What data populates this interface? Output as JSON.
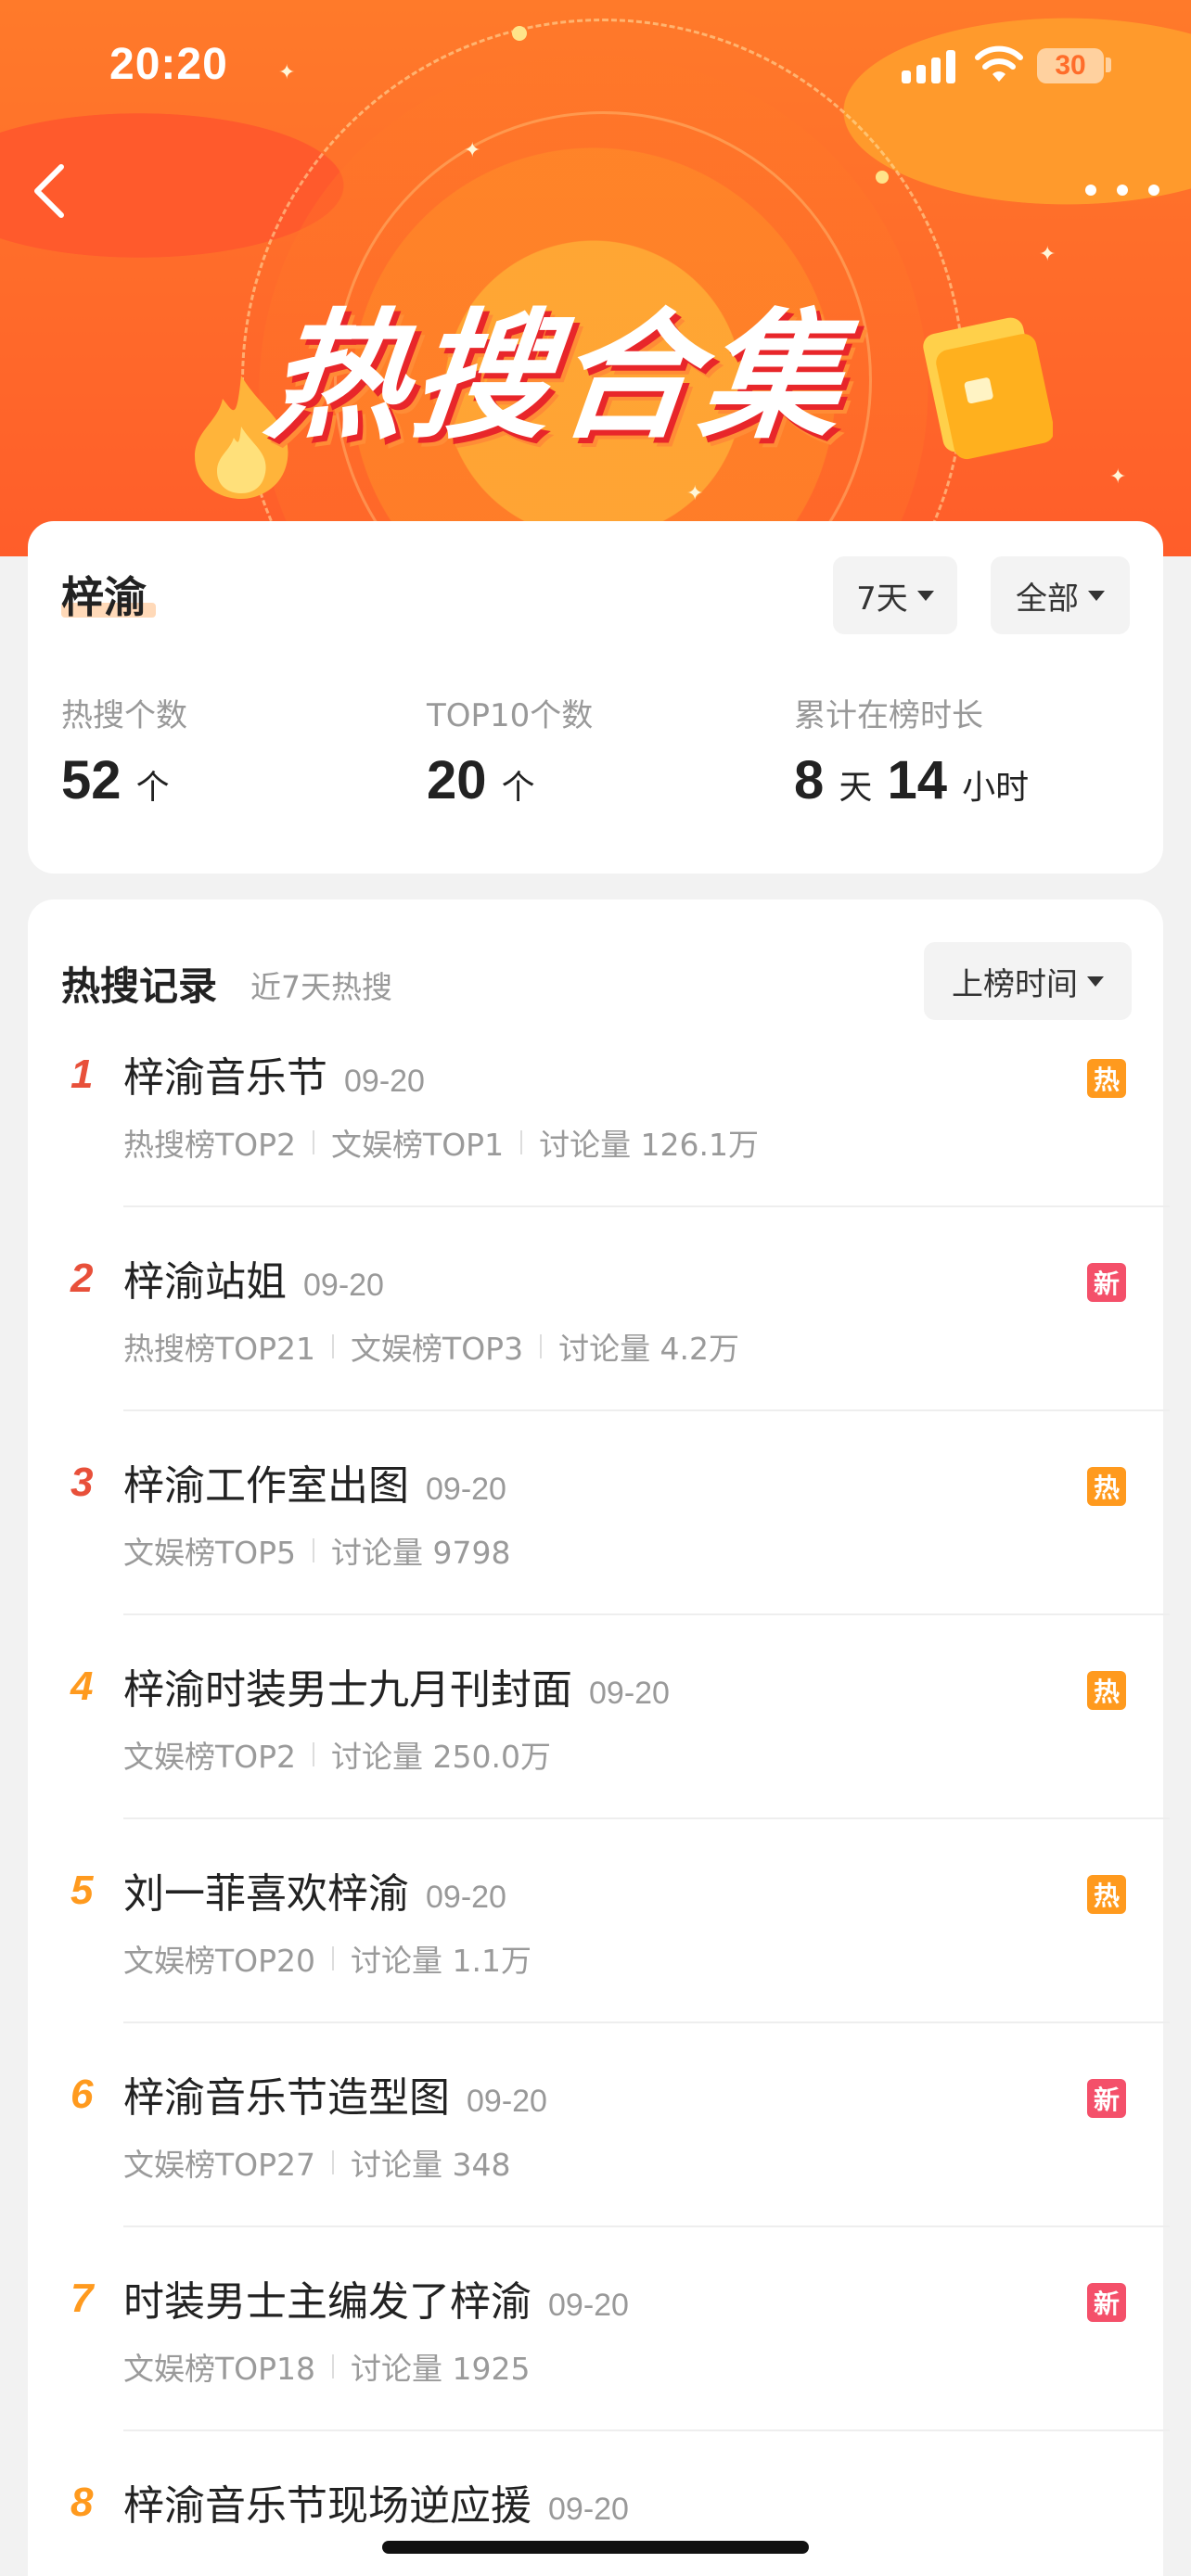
{
  "status_bar": {
    "time": "20:20",
    "battery": "30"
  },
  "banner": {
    "title": "热搜合集"
  },
  "summary": {
    "topic": "梓渝",
    "filters": {
      "days": "7天",
      "scope": "全部"
    },
    "stats": [
      {
        "label": "热搜个数",
        "value": "52",
        "unit": "个"
      },
      {
        "label": "TOP10个数",
        "value": "20",
        "unit": "个"
      },
      {
        "label": "累计在榜时长",
        "days": "8",
        "days_unit": "天",
        "hours": "14",
        "hours_unit": "小时"
      }
    ]
  },
  "records": {
    "title": "热搜记录",
    "subtitle": "近7天热搜",
    "sort_label": "上榜时间",
    "items": [
      {
        "rank": "1",
        "title": "梓渝音乐节",
        "date": "09-20",
        "meta": [
          "热搜榜TOP2",
          "文娱榜TOP1",
          "讨论量 126.1万"
        ],
        "badge": "热",
        "badge_type": "hot"
      },
      {
        "rank": "2",
        "title": "梓渝站姐",
        "date": "09-20",
        "meta": [
          "热搜榜TOP21",
          "文娱榜TOP3",
          "讨论量 4.2万"
        ],
        "badge": "新",
        "badge_type": "new"
      },
      {
        "rank": "3",
        "title": "梓渝工作室出图",
        "date": "09-20",
        "meta": [
          "文娱榜TOP5",
          "讨论量 9798"
        ],
        "badge": "热",
        "badge_type": "hot"
      },
      {
        "rank": "4",
        "title": "梓渝时装男士九月刊封面",
        "date": "09-20",
        "meta": [
          "文娱榜TOP2",
          "讨论量 250.0万"
        ],
        "badge": "热",
        "badge_type": "hot"
      },
      {
        "rank": "5",
        "title": "刘一菲喜欢梓渝",
        "date": "09-20",
        "meta": [
          "文娱榜TOP20",
          "讨论量 1.1万"
        ],
        "badge": "热",
        "badge_type": "hot"
      },
      {
        "rank": "6",
        "title": "梓渝音乐节造型图",
        "date": "09-20",
        "meta": [
          "文娱榜TOP27",
          "讨论量 348"
        ],
        "badge": "新",
        "badge_type": "new"
      },
      {
        "rank": "7",
        "title": "时装男士主编发了梓渝",
        "date": "09-20",
        "meta": [
          "文娱榜TOP18",
          "讨论量 1925"
        ],
        "badge": "新",
        "badge_type": "new"
      },
      {
        "rank": "8",
        "title": "梓渝音乐节现场逆应援",
        "date": "09-20",
        "meta": [],
        "badge": "",
        "badge_type": ""
      }
    ]
  },
  "colors": {
    "rank_top": "#e8503a",
    "rank_mid": "#ff9a1e",
    "badge_hot": "#ff9a1e",
    "badge_new": "#f4506a",
    "banner": "#ff6a2a"
  }
}
